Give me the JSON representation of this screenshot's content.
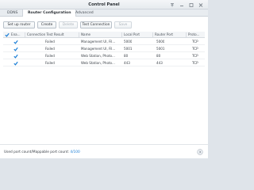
{
  "window": {
    "title": "Control Panel",
    "icons": {
      "pin": "pin-icon",
      "minimize": "minimize-icon",
      "maximize": "maximize-icon",
      "close": "close-icon"
    }
  },
  "tabs": [
    {
      "label": "DDNS",
      "active": false
    },
    {
      "label": "Router Configuration",
      "active": true
    },
    {
      "label": "Advanced",
      "active": false
    }
  ],
  "toolbar": {
    "setup_router": "Set up router",
    "create": "Create",
    "delete": "Delete",
    "test_connection": "Test Connection",
    "save": "Save"
  },
  "table": {
    "columns": {
      "enable": "Ena...",
      "result": "Connection Test Result",
      "name": "Name",
      "local_port": "Local Port",
      "router_port": "Router Port",
      "protocol": "Proto..."
    },
    "rows": [
      {
        "checked": true,
        "result": "Failed",
        "name": "Management UI, Fil...",
        "local_port": "5000",
        "router_port": "5000",
        "protocol": "TCP"
      },
      {
        "checked": true,
        "result": "Failed",
        "name": "Management UI, Fil...",
        "local_port": "5001",
        "router_port": "5001",
        "protocol": "TCP"
      },
      {
        "checked": true,
        "result": "Failed",
        "name": "Web Station, Photo...",
        "local_port": "80",
        "router_port": "80",
        "protocol": "TCP"
      },
      {
        "checked": true,
        "result": "Failed",
        "name": "Web Station, Photo...",
        "local_port": "443",
        "router_port": "443",
        "protocol": "TCP"
      }
    ]
  },
  "status": {
    "label": "Used port count/Mappable port count:",
    "count": "4/100"
  },
  "colors": {
    "accent": "#1d7fd6",
    "checkbox": "#1d7fd6"
  }
}
